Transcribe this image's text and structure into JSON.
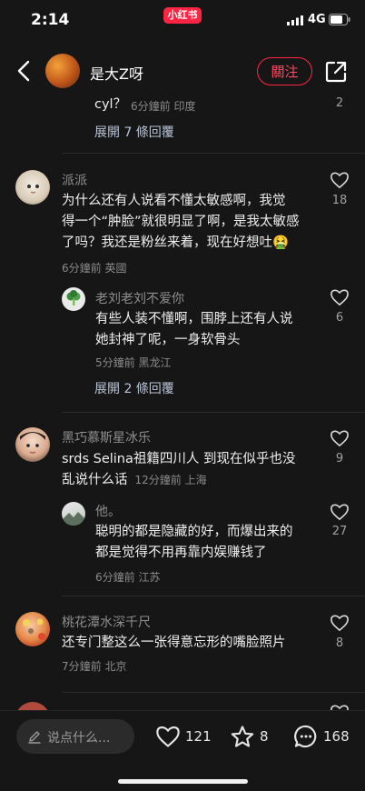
{
  "status": {
    "time": "2:14",
    "app_badge": "小红书",
    "network": "4G"
  },
  "nav": {
    "title": "是大Z呀",
    "follow_label": "關注"
  },
  "comments": [
    {
      "partial_text": "cyl？",
      "meta": "6分鐘前 印度",
      "likes": "2",
      "expand": "展開 7 條回覆"
    },
    {
      "name": "派派",
      "text_lines": [
        "为什么还有人说看不懂太敏感啊，我觉",
        "得一个“肿脸”就很明显了啊，是我太敏感",
        "了吗？我还是粉丝来着，现在好想吐"
      ],
      "emoji": "🤮",
      "meta": "6分鐘前 英國",
      "likes": "18",
      "reply": {
        "name": "老刘老刘不爱你",
        "text_lines": [
          "有些人装不懂啊，围脖上还有人说",
          "她封神了呢，一身软骨头"
        ],
        "meta": "5分鐘前 黑龙江",
        "likes": "6"
      },
      "expand": "展開 2 條回覆"
    },
    {
      "name": "黑巧慕斯星冰乐",
      "text_lines": [
        "srds Selina祖籍四川人 到现在似乎也没",
        "乱说什么话"
      ],
      "meta_inline": "12分鐘前 上海",
      "likes": "9",
      "reply": {
        "name": "他。",
        "text_lines": [
          "聪明的都是隐藏的好，而爆出来的",
          "都是觉得不用再靠内娱赚钱了"
        ],
        "meta": "6分鐘前 江苏",
        "likes": "27"
      }
    },
    {
      "name": "桃花潭水深千尺",
      "text_lines": [
        "还专门整这么一张得意忘形的嘴脸照片"
      ],
      "meta": "7分鐘前 北京",
      "likes": "8"
    }
  ],
  "bottom": {
    "placeholder": "说点什么...",
    "likes": "121",
    "stars": "8",
    "comments": "168"
  },
  "colors": {
    "accent": "#ff2442",
    "background": "#161616"
  }
}
